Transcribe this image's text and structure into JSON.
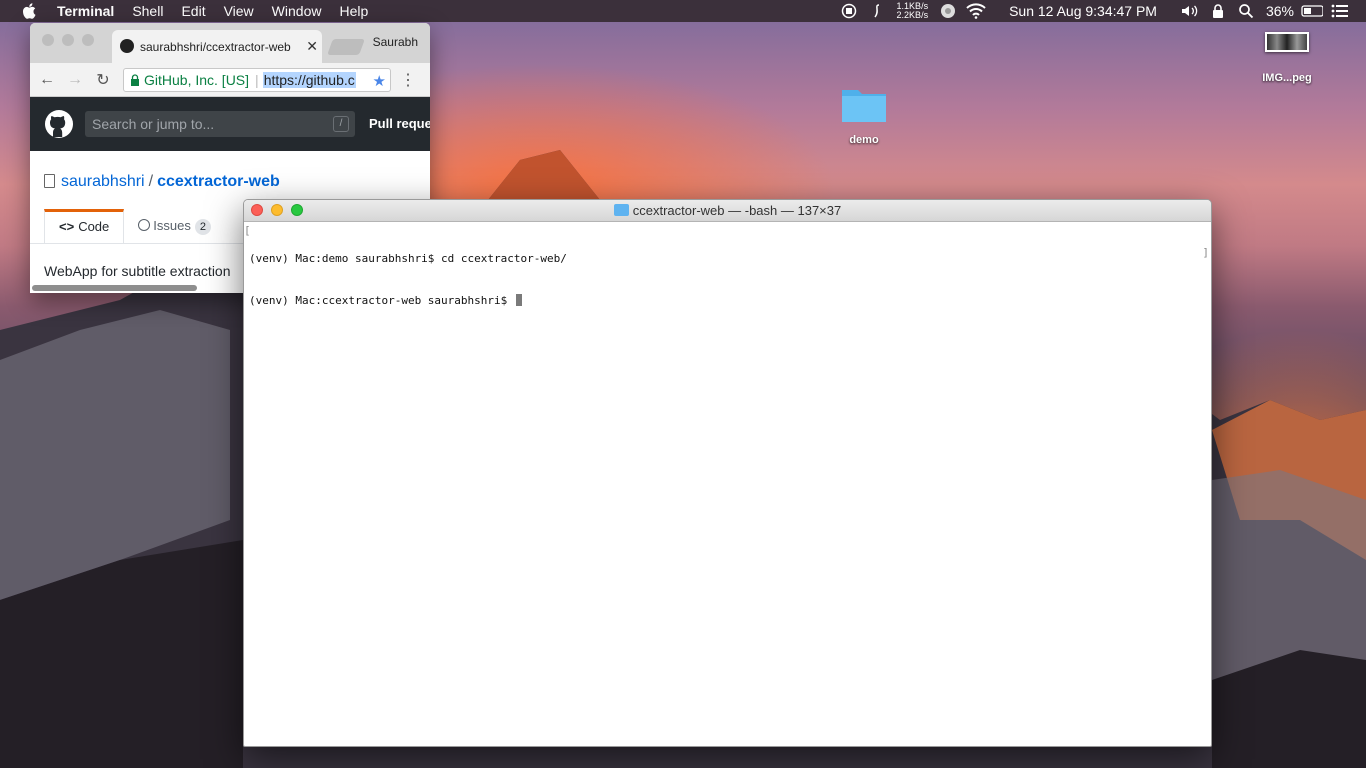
{
  "menubar": {
    "app_name": "Terminal",
    "items": [
      "Shell",
      "Edit",
      "View",
      "Window",
      "Help"
    ],
    "net_up": "1.1KB/s",
    "net_down": "2.2KB/s",
    "clock": "Sun 12 Aug  9:34:47 PM",
    "battery": "36%"
  },
  "desktop": {
    "folder_label": "demo",
    "image_label": "IMG...peg"
  },
  "chrome": {
    "tab_title": "saurabhshri/ccextractor-web",
    "profile_name": "Saurabh",
    "secure_label": "GitHub, Inc. [US]",
    "url": "https://github.c",
    "search_placeholder": "Search or jump to...",
    "search_shortcut": "/",
    "pull_requests": "Pull reque",
    "repo_owner": "saurabhshri",
    "repo_sep": "/",
    "repo_name": "ccextractor-web",
    "tab_code": "Code",
    "tab_issues": "Issues",
    "issues_count": "2",
    "description": "WebApp for subtitle extraction"
  },
  "terminal": {
    "title": "ccextractor-web — -bash — 137×37",
    "lines": [
      "(venv) Mac:demo saurabhshri$ cd ccextractor-web/",
      "(venv) Mac:ccextractor-web saurabhshri$ "
    ]
  }
}
